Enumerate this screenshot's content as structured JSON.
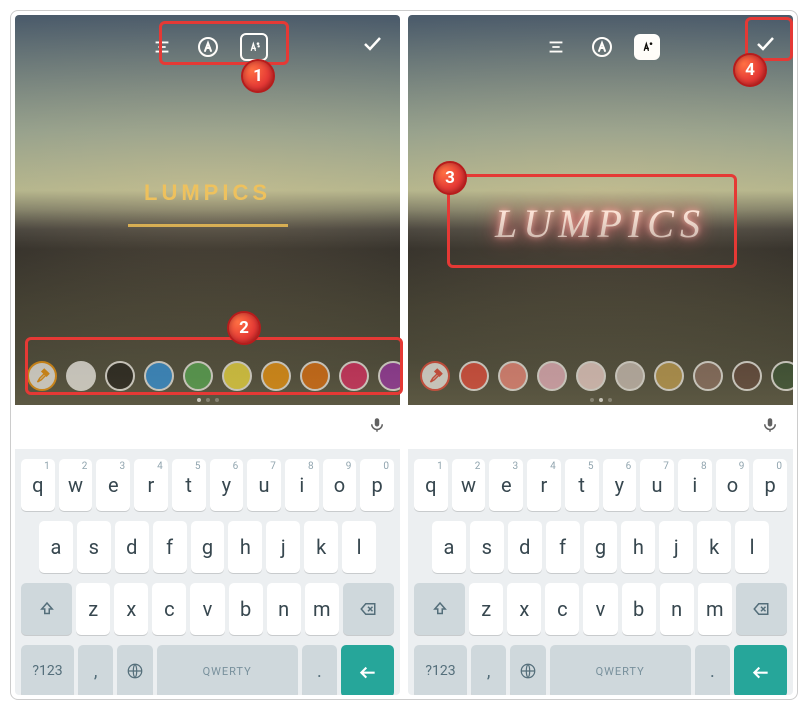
{
  "annotations": {
    "b1": "1",
    "b2": "2",
    "b3": "3",
    "b4": "4"
  },
  "left": {
    "text": "LUMPICS",
    "palette": [
      "#ffffff",
      "#111111",
      "#2196f3",
      "#4caf50",
      "#ffeb3b",
      "#ff9800",
      "#ef6c00",
      "#e91e63",
      "#9c27b0"
    ],
    "dots_active": 0
  },
  "right": {
    "text": "LUMPICS",
    "palette": [
      "#f44336",
      "#ff8a80",
      "#f8bbd0",
      "#ffe0e0",
      "#d7ccc8",
      "#c9a34d",
      "#8d6e63",
      "#5d4037",
      "#2e4d2e"
    ],
    "dots_active": 1
  },
  "keyboard": {
    "row1": [
      {
        "k": "q",
        "h": "1"
      },
      {
        "k": "w",
        "h": "2"
      },
      {
        "k": "e",
        "h": "3"
      },
      {
        "k": "r",
        "h": "4"
      },
      {
        "k": "t",
        "h": "5"
      },
      {
        "k": "y",
        "h": "6"
      },
      {
        "k": "u",
        "h": "7"
      },
      {
        "k": "i",
        "h": "8"
      },
      {
        "k": "o",
        "h": "9"
      },
      {
        "k": "p",
        "h": "0"
      }
    ],
    "row2": [
      "a",
      "s",
      "d",
      "f",
      "g",
      "h",
      "j",
      "k",
      "l"
    ],
    "row3": [
      "z",
      "x",
      "c",
      "v",
      "b",
      "n",
      "m"
    ],
    "sym": "?123",
    "comma": ",",
    "period": ".",
    "space": "QWERTY"
  }
}
